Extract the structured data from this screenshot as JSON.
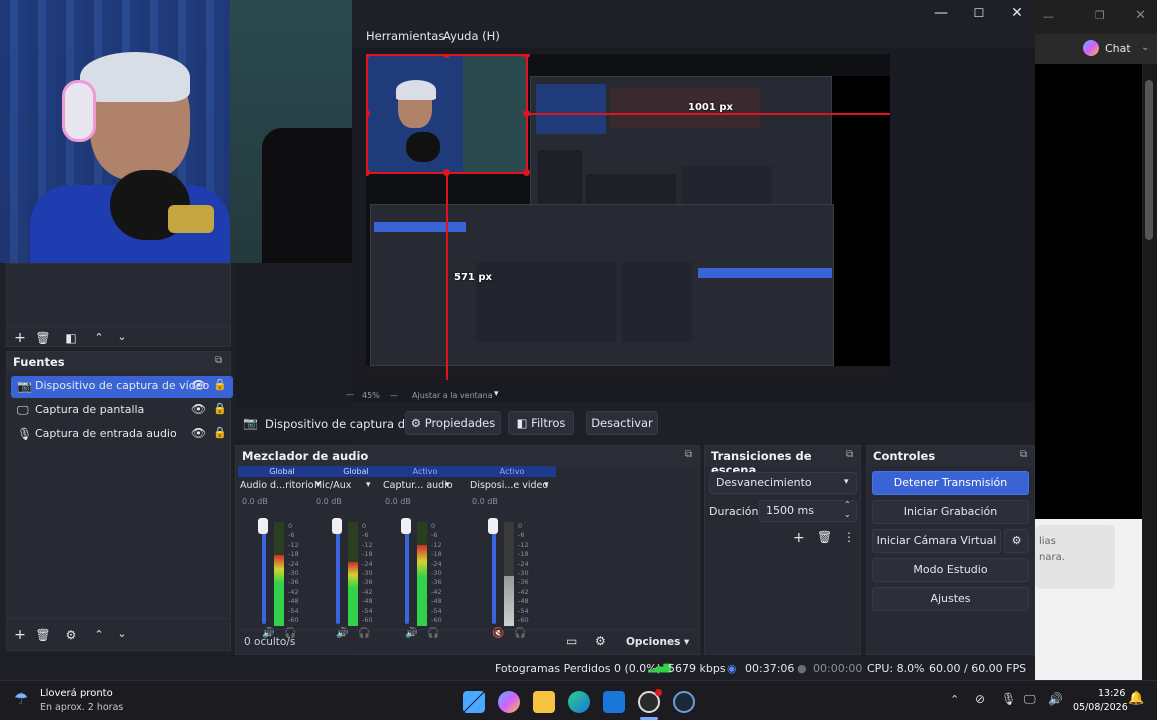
{
  "obs": {
    "menu": {
      "tools": "Herramientas",
      "help": "Ayuda (H)"
    },
    "window_controls": {
      "minimize": "—",
      "maximize": "☐",
      "close": "✕"
    },
    "preview": {
      "width_label": "1001 px",
      "height_label": "571 px",
      "zoom": "45%",
      "fit_label": "Ajustar a la ventana"
    },
    "sources_panel": {
      "title": "Fuentes",
      "items": [
        {
          "label": "Dispositivo de captura de vídeo",
          "selected": true
        },
        {
          "label": "Captura de pantalla",
          "selected": false
        },
        {
          "label": "Captura de entrada audio",
          "selected": false
        }
      ]
    },
    "source_bar": {
      "source_name": "Dispositivo de captura de v",
      "properties": "Propiedades",
      "filters": "Filtros",
      "deactivate": "Desactivar"
    },
    "mixer": {
      "title": "Mezclador de audio",
      "channels": [
        {
          "tag": "Global",
          "name": "Audio d...ritorio",
          "db": "0.0 dB",
          "level": 0.68
        },
        {
          "tag": "Global",
          "name": "Mic/Aux",
          "db": "0.0 dB",
          "level": 0.62
        },
        {
          "tag": "Activo",
          "name": "Captur... audio",
          "db": "0.0 dB",
          "level": 0.78
        },
        {
          "tag": "Activo",
          "name": "Disposi...e video",
          "db": "0.0 dB",
          "level": 0.48
        }
      ],
      "scale": [
        "0",
        "-6",
        "-12",
        "-18",
        "-24",
        "-30",
        "-36",
        "-42",
        "-48",
        "-54",
        "-60"
      ],
      "hidden": "0 oculto/s",
      "options": "Opciones"
    },
    "transitions": {
      "title": "Transiciones de escena",
      "selected": "Desvanecimiento",
      "duration_label": "Duración",
      "duration_value": "1500 ms"
    },
    "controls": {
      "title": "Controles",
      "stop_stream": "Detener Transmisión",
      "start_record": "Iniciar Grabación",
      "start_virtualcam": "Iniciar Cámara Virtual",
      "studio_mode": "Modo Estudio",
      "settings": "Ajustes"
    },
    "status": {
      "dropped": "Fotogramas Perdidos 0 (0.0%)",
      "bitrate": "5679 kbps",
      "stream_time": "00:37:06",
      "rec_time": "00:00:00",
      "cpu": "CPU: 8.0%",
      "fps": "60.00 / 60.00 FPS"
    }
  },
  "background_app": {
    "chat_label": "Chat",
    "partial_text_1": "lias",
    "partial_text_2": "nara."
  },
  "taskbar": {
    "weather_title": "Lloverá pronto",
    "weather_sub": "En aprox. 2 horas",
    "time": "13:26",
    "date": "05/08/2026"
  },
  "colors": {
    "accent": "#3a64d6",
    "obs_bg": "#1e1f27",
    "panel": "#272a33",
    "red": "#e0141c"
  }
}
